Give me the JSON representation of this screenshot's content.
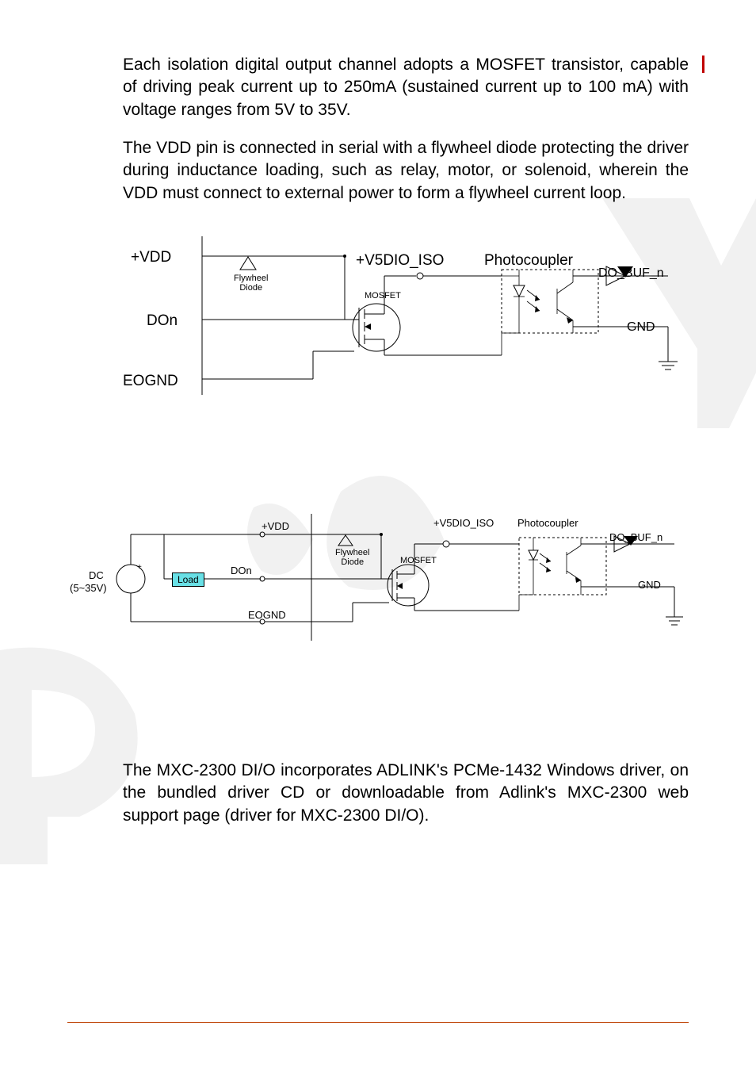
{
  "para1": "Each isolation digital output channel adopts a MOSFET transistor, capable of driving peak current up to 250mA (sustained current up to 100 mA) with voltage ranges from 5V to 35V.",
  "para2": "The VDD pin is connected in serial with a flywheel diode protecting the driver during inductance loading, such as relay, motor, or solenoid, wherein the VDD must connect to external power to form a flywheel current loop.",
  "para3": "The MXC-2300 DI/O incorporates ADLINK's PCMe-1432 Windows driver, on the bundled driver CD or downloadable from Adlink's MXC-2300 web support page (driver for MXC-2300 DI/O).",
  "d1": {
    "vdd": "+VDD",
    "don": "DOn",
    "eognd": "EOGND",
    "flydiode1": "Flywheel",
    "flydiode2": "Diode",
    "mosfet": "MOSFET",
    "v5iso": "+V5DIO_ISO",
    "photo": "Photocoupler",
    "dobuf": "DO_BUF_n",
    "gnd": "GND"
  },
  "d2": {
    "dc1": "DC",
    "dc2": "(5~35V)",
    "plus": "+",
    "minus": "-",
    "load": "Load",
    "vdd": "+VDD",
    "don": "DOn",
    "eognd": "EOGND",
    "flydiode1": "Flywheel",
    "flydiode2": "Diode",
    "mosfet": "MOSFET",
    "v5iso": "+V5DIO_ISO",
    "photo": "Photocoupler",
    "dobuf": "DO_BUF_n",
    "gnd": "GND"
  }
}
